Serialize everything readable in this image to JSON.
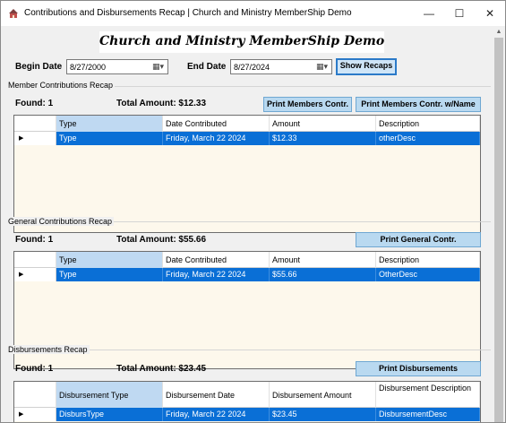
{
  "window": {
    "title": "Contributions and Disbursements Recap | Church and Ministry MemberShip Demo",
    "minimize": "—",
    "maximize": "☐",
    "close": "✕",
    "icon": "app-icon"
  },
  "banner": {
    "title": "Church and Ministry MemberShip Demo"
  },
  "filters": {
    "begin_label": "Begin Date",
    "begin_value": "8/27/2000",
    "end_label": "End Date",
    "end_value": "8/27/2024",
    "calendar_glyph": "▦▾",
    "show_button": "Show Recaps"
  },
  "member_section": {
    "title": "Member Contributions Recap",
    "found_label": "Found: 1",
    "total_label": "Total Amount: $12.33",
    "print_button": "Print Members Contr.",
    "print_named_button": "Print Members Contr. w/Name",
    "columns": [
      "Type",
      "Date Contributed",
      "Amount",
      "Description"
    ],
    "rows": [
      {
        "indicator": "▶",
        "cells": [
          "Type",
          "Friday, March 22 2024",
          "$12.33",
          "otherDesc"
        ]
      }
    ]
  },
  "general_section": {
    "title": "General Contributions Recap",
    "found_label": "Found: 1",
    "total_label": "Total Amount: $55.66",
    "print_button": "Print General Contr.",
    "columns": [
      "Type",
      "Date Contributed",
      "Amount",
      "Description"
    ],
    "rows": [
      {
        "indicator": "▶",
        "cells": [
          "Type",
          "Friday, March 22 2024",
          "$55.66",
          "OtherDesc"
        ]
      }
    ]
  },
  "disburse_section": {
    "title": "Disbursements Recap",
    "found_label": "Found: 1",
    "total_label": "Total Amount: $23.45",
    "print_button": "Print Disbursements",
    "columns": [
      "Disbursement Type",
      "Disbursement Date",
      "Disbursement Amount",
      "Disbursement Description"
    ],
    "rows": [
      {
        "indicator": "▶",
        "cells": [
          "DisbursType",
          "Friday, March 22 2024",
          "$23.45",
          "DisbursementDesc"
        ]
      }
    ]
  },
  "colors": {
    "selection": "#0a6fd6",
    "accent_button": "#b9d9f0",
    "grid_background": "#fdf8ec"
  }
}
